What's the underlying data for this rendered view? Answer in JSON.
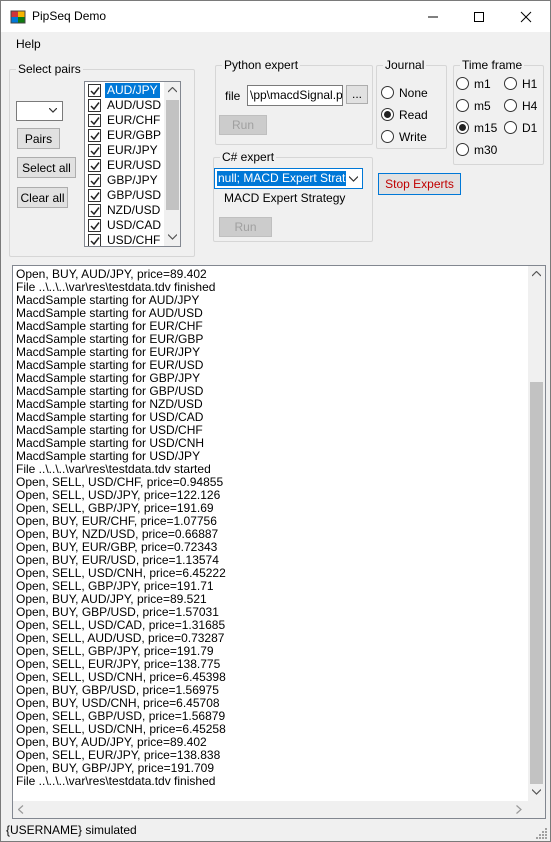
{
  "window": {
    "title": "PipSeq Demo"
  },
  "menu": {
    "help": "Help"
  },
  "select_pairs": {
    "label": "Select  pairs",
    "combo_value": "",
    "pairs_button": "Pairs",
    "select_all_button": "Select all",
    "clear_all_button": "Clear all",
    "items": [
      {
        "label": "AUD/JPY",
        "checked": true,
        "selected": true
      },
      {
        "label": "AUD/USD",
        "checked": true,
        "selected": false
      },
      {
        "label": "EUR/CHF",
        "checked": true,
        "selected": false
      },
      {
        "label": "EUR/GBP",
        "checked": true,
        "selected": false
      },
      {
        "label": "EUR/JPY",
        "checked": true,
        "selected": false
      },
      {
        "label": "EUR/USD",
        "checked": true,
        "selected": false
      },
      {
        "label": "GBP/JPY",
        "checked": true,
        "selected": false
      },
      {
        "label": "GBP/USD",
        "checked": true,
        "selected": false
      },
      {
        "label": "NZD/USD",
        "checked": true,
        "selected": false
      },
      {
        "label": "USD/CAD",
        "checked": true,
        "selected": false
      },
      {
        "label": "USD/CHF",
        "checked": true,
        "selected": false
      }
    ]
  },
  "python_expert": {
    "label": "Python expert",
    "file_label": "file",
    "file_value": "\\pp\\macdSignal.py",
    "browse_button": "...",
    "run_button": "Run"
  },
  "csharp_expert": {
    "label": "C# expert",
    "combo_value": "null; MACD Expert Strategy",
    "description": "MACD Expert Strategy",
    "run_button": "Run"
  },
  "stop_button": "Stop Experts",
  "journal": {
    "label": "Journal",
    "options": [
      "None",
      "Read",
      "Write"
    ],
    "selected": "Read"
  },
  "timeframe": {
    "label": "Time frame",
    "options": [
      "m1",
      "H1",
      "m5",
      "H4",
      "m15",
      "D1",
      "m30"
    ],
    "selected": "m15"
  },
  "log": [
    "Open, BUY, AUD/JPY, price=89.402",
    "File ..\\..\\..\\var\\res\\testdata.tdv finished",
    "MacdSample starting for AUD/JPY",
    "MacdSample starting for AUD/USD",
    "MacdSample starting for EUR/CHF",
    "MacdSample starting for EUR/GBP",
    "MacdSample starting for EUR/JPY",
    "MacdSample starting for EUR/USD",
    "MacdSample starting for GBP/JPY",
    "MacdSample starting for GBP/USD",
    "MacdSample starting for NZD/USD",
    "MacdSample starting for USD/CAD",
    "MacdSample starting for USD/CHF",
    "MacdSample starting for USD/CNH",
    "MacdSample starting for USD/JPY",
    "File ..\\..\\..\\var\\res\\testdata.tdv started",
    "Open, SELL, USD/CHF, price=0.94855",
    "Open, SELL, USD/JPY, price=122.126",
    "Open, SELL, GBP/JPY, price=191.69",
    "Open, BUY, EUR/CHF, price=1.07756",
    "Open, BUY, NZD/USD, price=0.66887",
    "Open, BUY, EUR/GBP, price=0.72343",
    "Open, BUY, EUR/USD, price=1.13574",
    "Open, SELL, USD/CNH, price=6.45222",
    "Open, SELL, GBP/JPY, price=191.71",
    "Open, BUY, AUD/JPY, price=89.521",
    "Open, BUY, GBP/USD, price=1.57031",
    "Open, SELL, USD/CAD, price=1.31685",
    "Open, SELL, AUD/USD, price=0.73287",
    "Open, SELL, GBP/JPY, price=191.79",
    "Open, SELL, EUR/JPY, price=138.775",
    "Open, SELL, USD/CNH, price=6.45398",
    "Open, BUY, GBP/USD, price=1.56975",
    "Open, BUY, USD/CNH, price=6.45708",
    "Open, SELL, GBP/USD, price=1.56879",
    "Open, SELL, USD/CNH, price=6.45258",
    "Open, BUY, AUD/JPY, price=89.402",
    "Open, SELL, EUR/JPY, price=138.838",
    "Open, BUY, GBP/JPY, price=191.709",
    "File ..\\..\\..\\var\\res\\testdata.tdv finished"
  ],
  "status": {
    "text": "{USERNAME}  simulated"
  },
  "colors": {
    "accent": "#0078d7",
    "window_bg": "#f0f0f0",
    "stop_text": "#c00000"
  }
}
